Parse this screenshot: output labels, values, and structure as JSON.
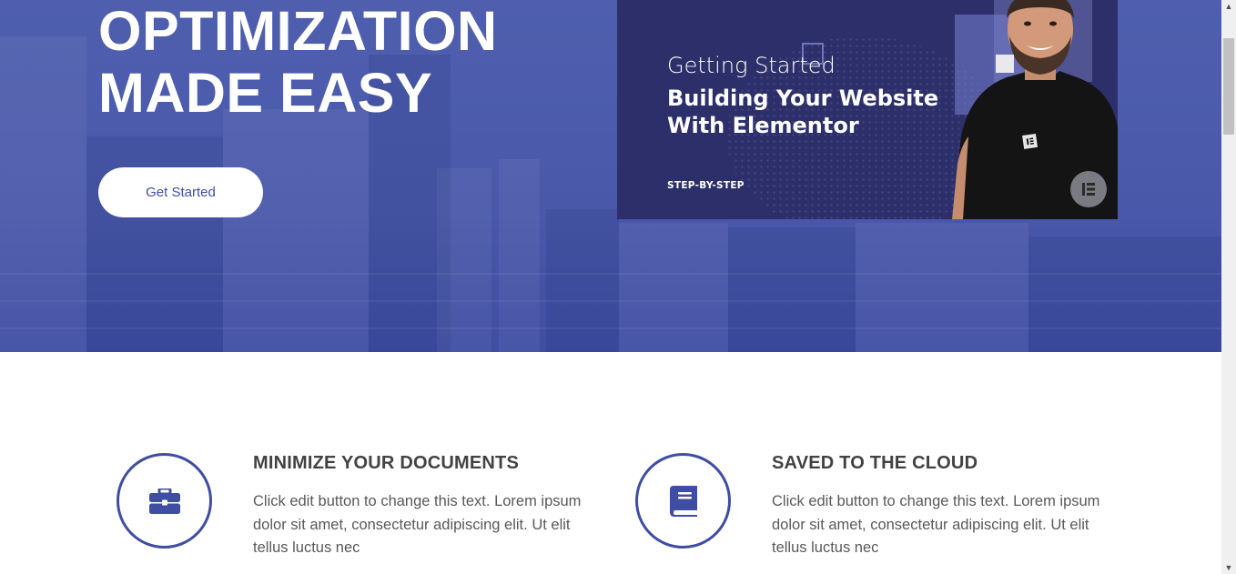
{
  "hero": {
    "title_line1": "OPTIMIZATION",
    "title_line2": "MADE EASY",
    "button_label": "Get Started",
    "background_color": "#4a58aa"
  },
  "video_thumb": {
    "subtitle": "Getting Started",
    "title_line1": "Building Your Website",
    "title_line2": "With Elementor",
    "tag": "STEP-BY-STEP",
    "logo_icon": "elementor-logo-icon",
    "background_color": "#2d2f6b"
  },
  "features": [
    {
      "icon": "briefcase-icon",
      "title": "MINIMIZE YOUR DOCUMENTS",
      "text": "Click edit button to change this text. Lorem ipsum dolor sit amet, consectetur adipiscing elit. Ut elit tellus luctus nec"
    },
    {
      "icon": "book-icon",
      "title": "SAVED TO THE CLOUD",
      "text": "Click edit button to change this text. Lorem ipsum dolor sit amet, consectetur adipiscing elit. Ut elit tellus luctus nec"
    }
  ],
  "colors": {
    "accent": "#3f4da3",
    "heading": "#424242",
    "body_text": "#595959"
  }
}
